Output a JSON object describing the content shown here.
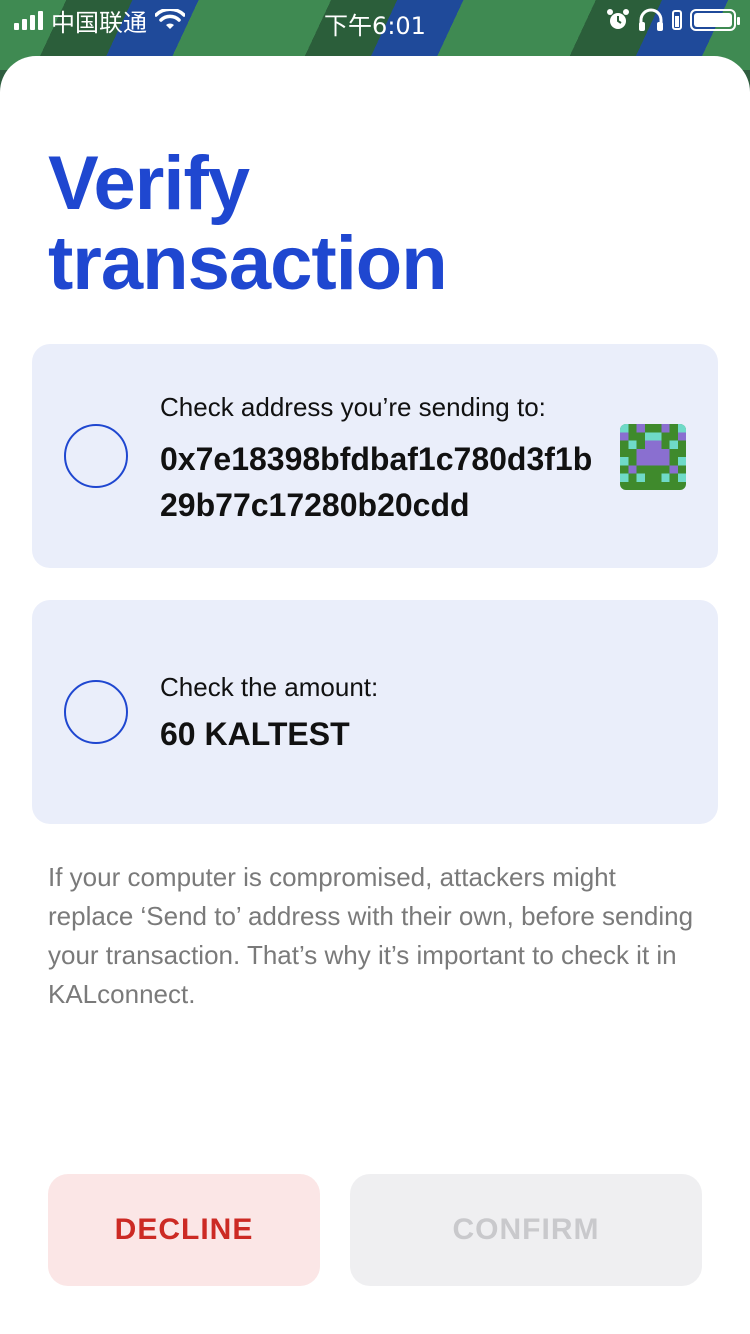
{
  "status_bar": {
    "carrier": "中国联通",
    "time": "下午6:01"
  },
  "title": "Verify transaction",
  "address_card": {
    "label": "Check address you’re sending to:",
    "address": "0x7e18398bfdbaf1c780d3f1b29b77c17280b20cdd",
    "identicon": "address-identicon"
  },
  "amount_card": {
    "label": "Check the amount:",
    "amount": "60 KALTEST"
  },
  "note": "If your computer is compromised, attackers might replace ‘Send to’ address with their own, before sending your transaction. That’s why it’s important to check it in KALconnect.",
  "buttons": {
    "decline": "DECLINE",
    "confirm": "CONFIRM"
  },
  "colors": {
    "accent": "#1f47d0",
    "card_bg": "#eaeefa",
    "decline_text": "#cc2a24",
    "decline_bg": "#fbe6e6",
    "confirm_disabled_text": "#c9c9cc",
    "confirm_disabled_bg": "#efeff1",
    "note_text": "#7a7a7a"
  }
}
